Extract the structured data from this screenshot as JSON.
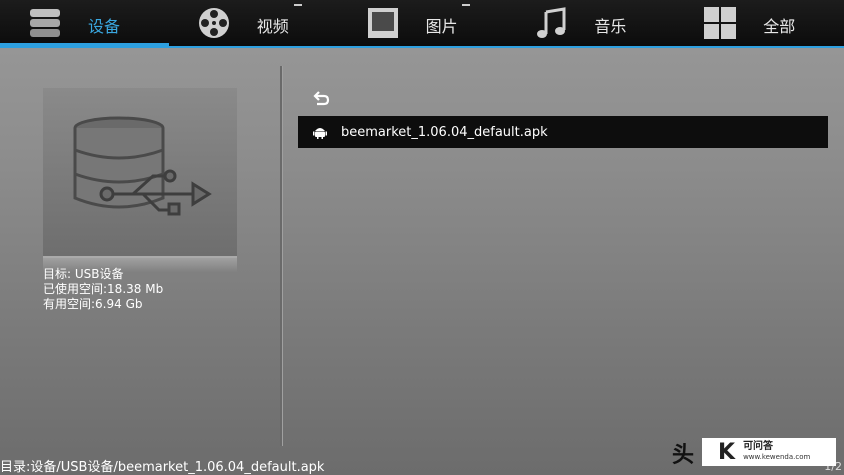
{
  "tabs": [
    {
      "label": "设备",
      "icon": "storage-icon",
      "active": true
    },
    {
      "label": "视频",
      "icon": "film-reel-icon",
      "active": false
    },
    {
      "label": "图片",
      "icon": "picture-frame-icon",
      "active": false
    },
    {
      "label": "音乐",
      "icon": "music-note-icon",
      "active": false
    },
    {
      "label": "全部",
      "icon": "grid-icon",
      "active": false
    }
  ],
  "device": {
    "icon": "usb-storage-icon",
    "target": "目标: USB设备",
    "used": "已使用空间:18.38 Mb",
    "free": "有用空间:6.94 Gb"
  },
  "file_list": {
    "back_icon": "back-arrow-icon",
    "items": [
      {
        "name": "beemarket_1.06.04_default.apk",
        "icon": "android-icon",
        "selected": true
      }
    ]
  },
  "footer": {
    "path": "目录:设备/USB设备/beemarket_1.06.04_default.apk",
    "page": "1/2"
  },
  "watermark": {
    "head": "头",
    "logo": "K",
    "site_name": "可问答",
    "site_url": "www.kewenda.com"
  },
  "colors": {
    "accent": "#2ea0e0",
    "tabbar": "#111111",
    "selected_row": "#0d0d0d"
  }
}
